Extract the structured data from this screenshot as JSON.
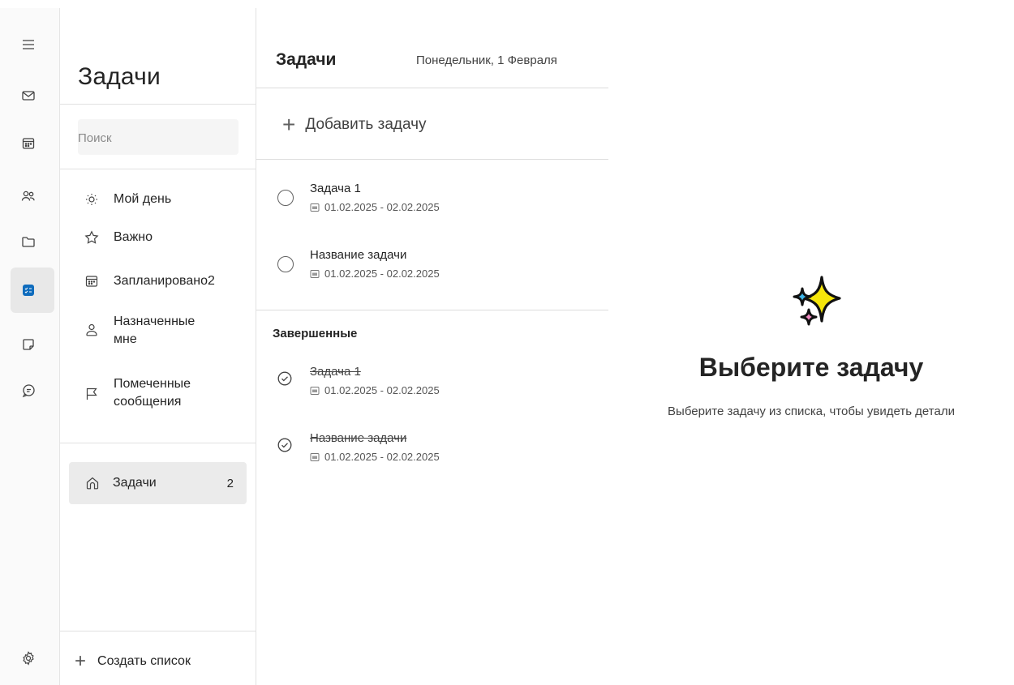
{
  "rail": {
    "items": [
      {
        "name": "menu-icon"
      },
      {
        "name": "mail-icon"
      },
      {
        "name": "calendar-icon"
      },
      {
        "name": "people-icon"
      },
      {
        "name": "folder-icon"
      },
      {
        "name": "todo-icon",
        "active": true
      },
      {
        "name": "notes-icon"
      },
      {
        "name": "chat-icon"
      },
      {
        "name": "settings-icon"
      }
    ],
    "accent": "#0f6cbd"
  },
  "pane": {
    "title": "Задачи",
    "search_placeholder": "Поиск",
    "nav": [
      {
        "label": "Мой день",
        "icon": "sun-icon"
      },
      {
        "label": "Важно",
        "icon": "star-icon"
      },
      {
        "label": "Запланировано2",
        "icon": "calendar-icon"
      },
      {
        "label": "Назначенные мне",
        "icon": "person-icon"
      },
      {
        "label": "Помеченные сообщения",
        "icon": "flag-icon"
      }
    ],
    "lists": [
      {
        "label": "Задачи",
        "count": "2",
        "icon": "home-icon"
      }
    ],
    "create_list_label": "Создать список"
  },
  "tasks": {
    "title": "Задачи",
    "date": "Понедельник, 1 Февраля",
    "add_label": "Добавить задачу",
    "open": [
      {
        "title": "Задача 1",
        "dates": "01.02.2025 - 02.02.2025"
      },
      {
        "title": "Название задачи",
        "dates": "01.02.2025 - 02.02.2025"
      }
    ],
    "completed_label": "Завершенные",
    "completed": [
      {
        "title": "Задача 1",
        "dates": "01.02.2025 - 02.02.2025"
      },
      {
        "title": "Название задачи",
        "dates": "01.02.2025 - 02.02.2025"
      }
    ]
  },
  "empty_state": {
    "title": "Выберите задачу",
    "subtitle": "Выберите задачу из списка, чтобы увидеть детали",
    "icon": "sparkles-icon"
  }
}
